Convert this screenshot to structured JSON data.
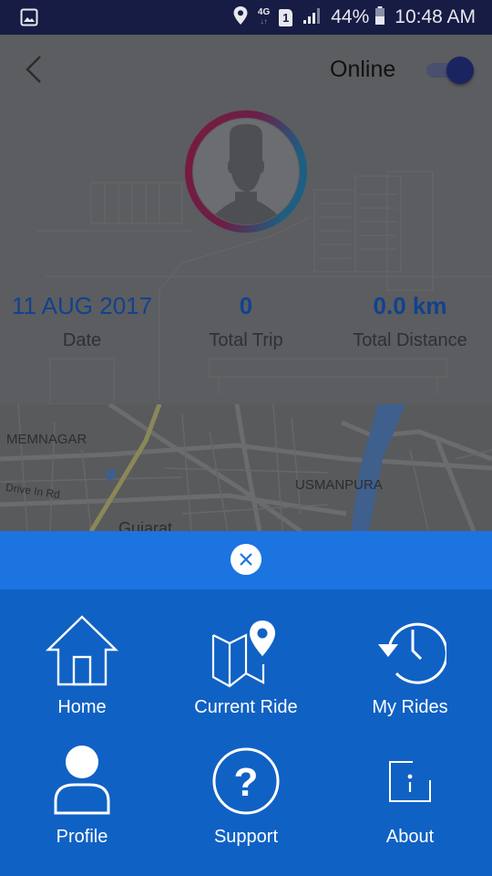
{
  "status_bar": {
    "network_type": "4G",
    "sim_slot": "1",
    "battery_percent": "44%",
    "time": "10:48 AM",
    "icons": [
      "gallery-icon",
      "location-icon",
      "4g-icon",
      "sim-icon",
      "signal-icon",
      "battery-icon"
    ]
  },
  "header": {
    "back_icon": "chevron-left-icon",
    "status_label": "Online",
    "online_toggle_on": true
  },
  "profile": {
    "avatar_icon": "person-silhouette-icon"
  },
  "stats": {
    "date": {
      "value": "11 AUG 2017",
      "label": "Date"
    },
    "total_trip": {
      "value": "0",
      "label": "Total Trip"
    },
    "total_distance": {
      "value": "0.0 km",
      "label": "Total Distance"
    }
  },
  "map": {
    "labels": [
      "MEMNAGAR",
      "Drive In Rd",
      "USMANPURA",
      "Gujarat"
    ]
  },
  "menu": {
    "close_icon": "close-icon",
    "items": [
      {
        "label": "Home",
        "icon": "home-icon"
      },
      {
        "label": "Current Ride",
        "icon": "map-pin-icon"
      },
      {
        "label": "My Rides",
        "icon": "history-icon"
      },
      {
        "label": "Profile",
        "icon": "person-icon"
      },
      {
        "label": "Support",
        "icon": "help-circle-icon"
      },
      {
        "label": "About",
        "icon": "info-icon"
      }
    ]
  },
  "colors": {
    "status_bar": "#171c45",
    "menu_header": "#1b74e0",
    "menu_body": "#1061c4",
    "stat_value": "#12428d",
    "toggle_knob": "#1a2461"
  }
}
